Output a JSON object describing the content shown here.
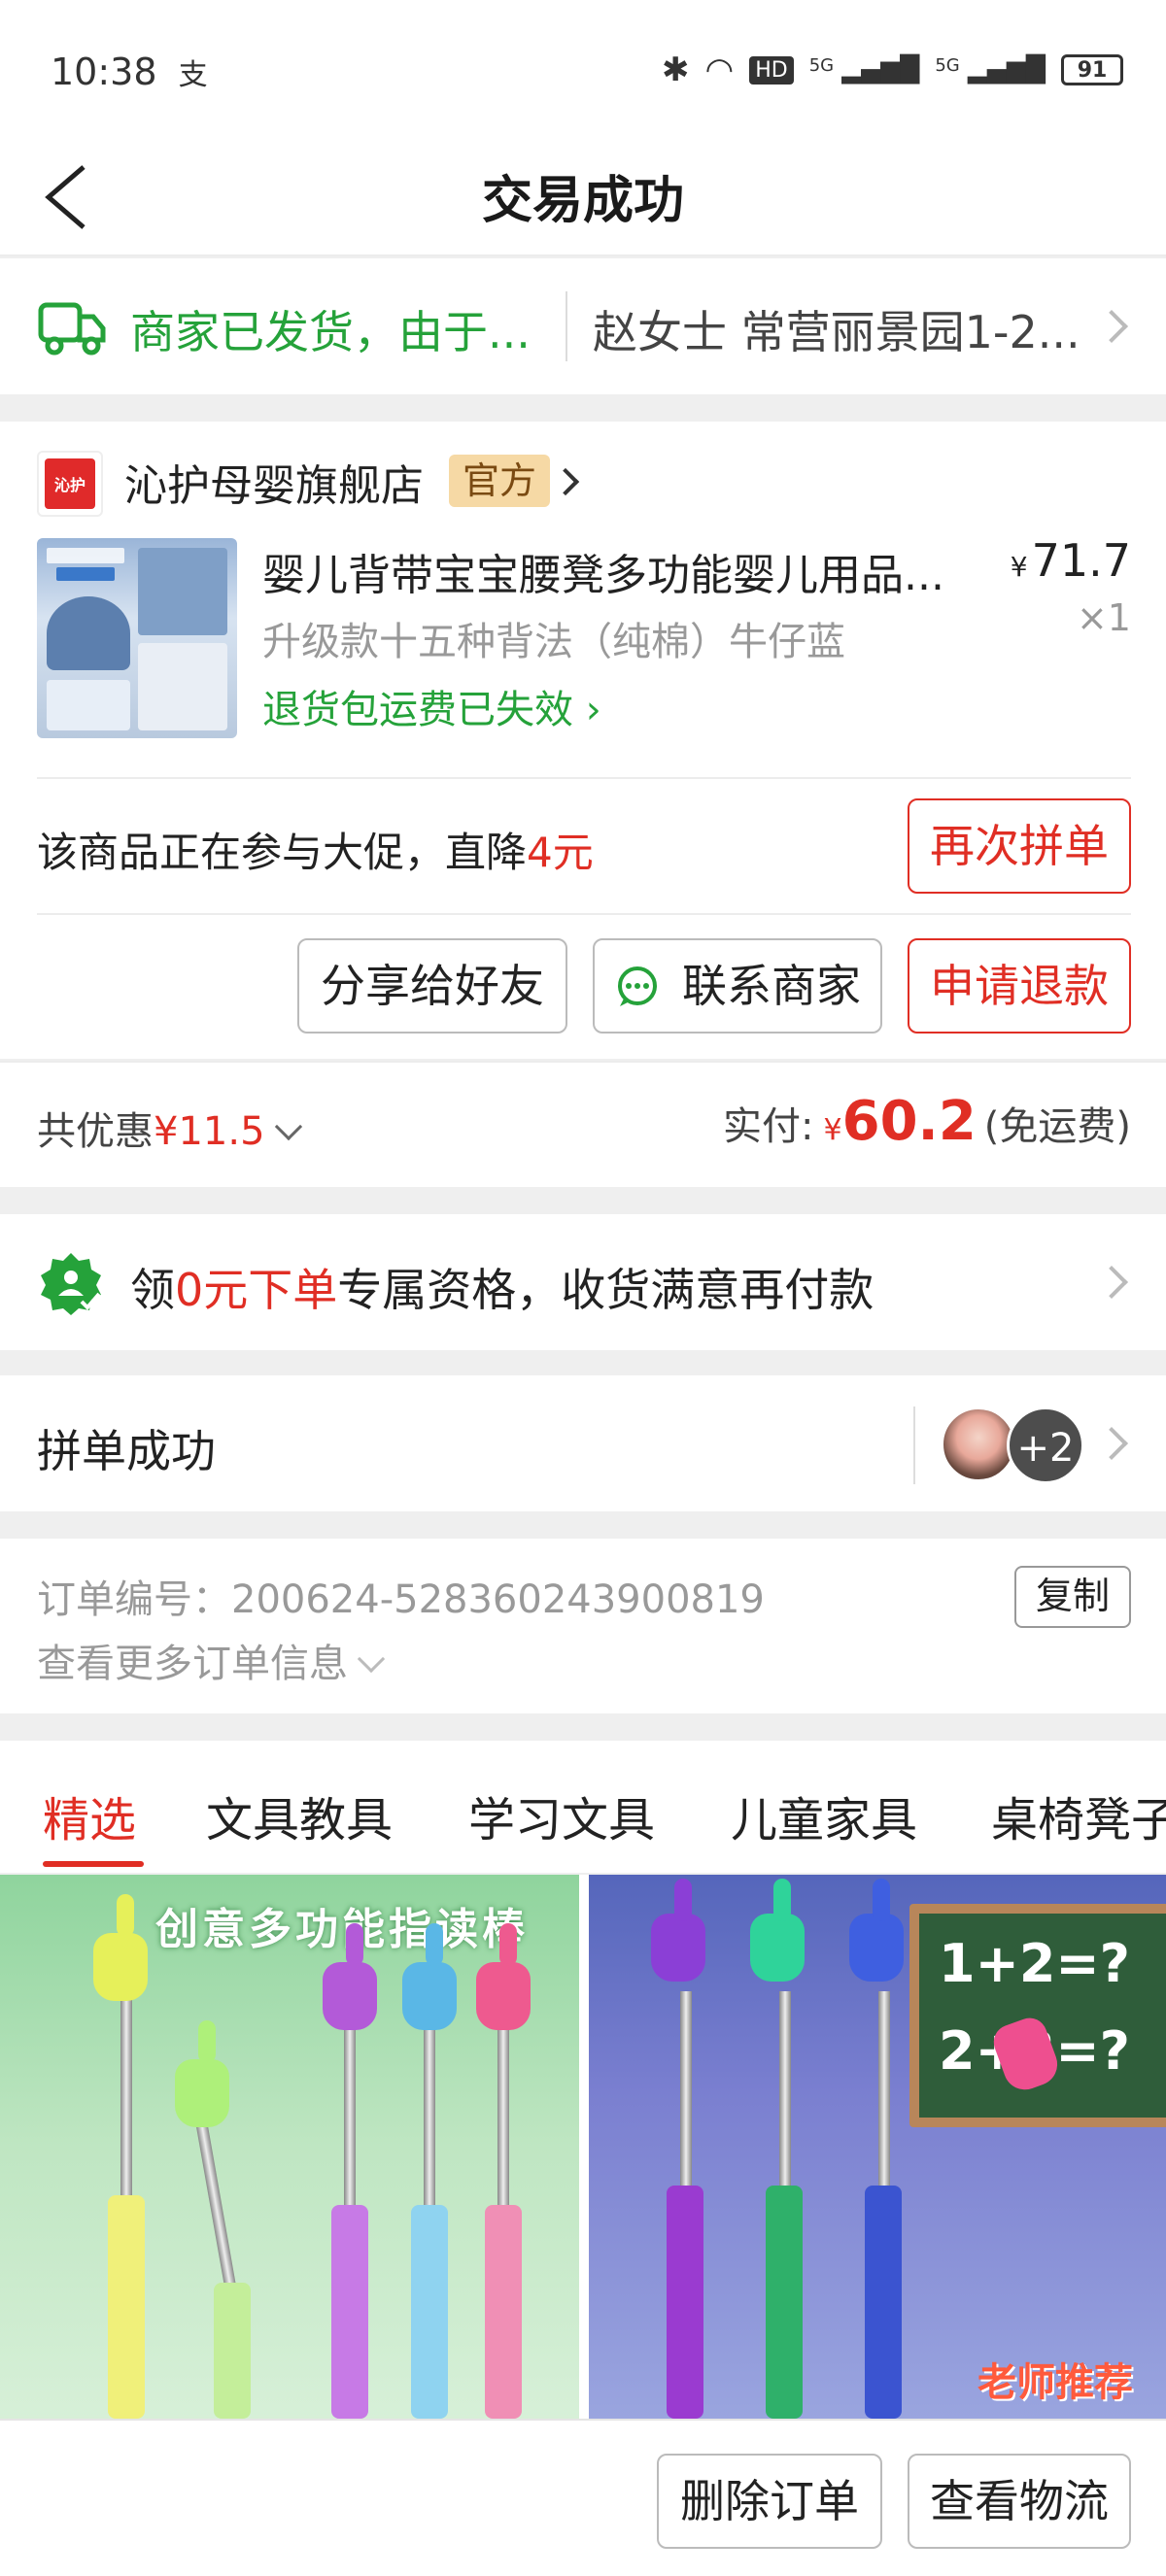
{
  "status_bar": {
    "time": "10:38",
    "carrier_glyph": "支",
    "network_1": "5G",
    "network_2": "5G",
    "hd": "HD",
    "battery": "91"
  },
  "nav": {
    "title": "交易成功"
  },
  "logistics": {
    "status": "商家已发货，由于...",
    "address": "赵女士 常营丽景园1-2...",
    "status_color": "#25a23a"
  },
  "store": {
    "logo_text": "沁护",
    "name": "沁护母婴旗舰店",
    "badge": "官方"
  },
  "product": {
    "title": "婴儿背带宝宝腰凳多功能婴儿用品...",
    "spec": "升级款十五种背法（纯棉）牛仔蓝",
    "return_notice": "退货包运费已失效",
    "currency": "¥",
    "price": "71.7",
    "quantity": "×1"
  },
  "promo": {
    "text_prefix": "该商品正在参与大促，直降",
    "amount": "4元",
    "regroup_button": "再次拼单"
  },
  "actions": {
    "share": "分享给好友",
    "contact": "联系商家",
    "refund": "申请退款"
  },
  "totals": {
    "discount_label": "共优惠",
    "discount_amount": "¥11.5",
    "paid_label": "实付:",
    "currency": "¥",
    "paid_amount": "60.2",
    "shipping": "(免运费)"
  },
  "zero_pay": {
    "prefix": "领",
    "highlight": "0元下单",
    "suffix": "专属资格，收货满意再付款"
  },
  "group": {
    "label": "拼单成功",
    "more_count": "+2"
  },
  "order": {
    "number_label": "订单编号：",
    "number": "200624-528360243900819",
    "copy_button": "复制",
    "more_info": "查看更多订单信息"
  },
  "tabs": [
    {
      "label": "精选",
      "active": true
    },
    {
      "label": "文具教具",
      "active": false
    },
    {
      "label": "学习文具",
      "active": false
    },
    {
      "label": "儿童家具",
      "active": false
    },
    {
      "label": "桌椅凳子",
      "active": false
    }
  ],
  "products": [
    {
      "caption": "创意多功能指读棒"
    },
    {
      "board_line1": "1+2=?",
      "board_line2": "2+3=?",
      "caption": "老师推荐"
    }
  ],
  "bottom_bar": {
    "delete": "删除订单",
    "logistics": "查看物流"
  },
  "colors": {
    "accent_red": "#e02e24",
    "accent_green": "#25a23a",
    "badge_bg": "#f6d9a5"
  }
}
